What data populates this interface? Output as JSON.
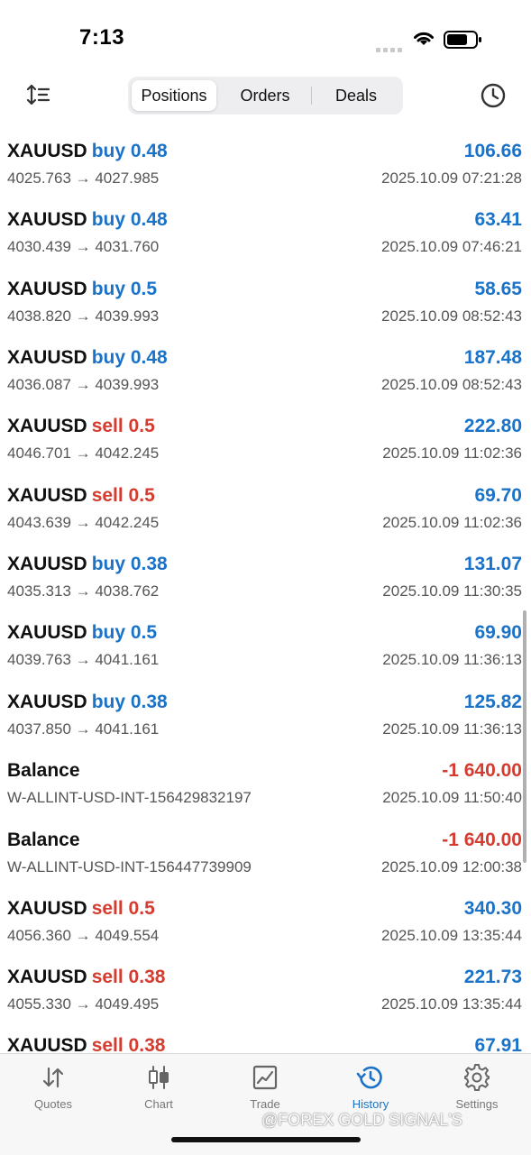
{
  "status_bar": {
    "time": "7:13"
  },
  "toolbar": {
    "segments": [
      {
        "label": "Positions",
        "active": true
      },
      {
        "label": "Orders",
        "active": false
      },
      {
        "label": "Deals",
        "active": false
      }
    ],
    "sort_icon": "sort-icon",
    "history_icon": "clock-icon"
  },
  "rows": [
    {
      "title": "XAUUSD",
      "direction": "buy 0.48",
      "dir_type": "buy",
      "profit": "106.66",
      "profit_sign": "pos",
      "detail": "4025.763 → 4027.985",
      "time": "2025.10.09 07:21:28"
    },
    {
      "title": "XAUUSD",
      "direction": "buy 0.48",
      "dir_type": "buy",
      "profit": "63.41",
      "profit_sign": "pos",
      "detail": "4030.439 → 4031.760",
      "time": "2025.10.09 07:46:21"
    },
    {
      "title": "XAUUSD",
      "direction": "buy 0.5",
      "dir_type": "buy",
      "profit": "58.65",
      "profit_sign": "pos",
      "detail": "4038.820 → 4039.993",
      "time": "2025.10.09 08:52:43"
    },
    {
      "title": "XAUUSD",
      "direction": "buy 0.48",
      "dir_type": "buy",
      "profit": "187.48",
      "profit_sign": "pos",
      "detail": "4036.087 → 4039.993",
      "time": "2025.10.09 08:52:43"
    },
    {
      "title": "XAUUSD",
      "direction": "sell 0.5",
      "dir_type": "sell",
      "profit": "222.80",
      "profit_sign": "pos",
      "detail": "4046.701 → 4042.245",
      "time": "2025.10.09 11:02:36"
    },
    {
      "title": "XAUUSD",
      "direction": "sell 0.5",
      "dir_type": "sell",
      "profit": "69.70",
      "profit_sign": "pos",
      "detail": "4043.639 → 4042.245",
      "time": "2025.10.09 11:02:36"
    },
    {
      "title": "XAUUSD",
      "direction": "buy 0.38",
      "dir_type": "buy",
      "profit": "131.07",
      "profit_sign": "pos",
      "detail": "4035.313 → 4038.762",
      "time": "2025.10.09 11:30:35"
    },
    {
      "title": "XAUUSD",
      "direction": "buy 0.5",
      "dir_type": "buy",
      "profit": "69.90",
      "profit_sign": "pos",
      "detail": "4039.763 → 4041.161",
      "time": "2025.10.09 11:36:13"
    },
    {
      "title": "XAUUSD",
      "direction": "buy 0.38",
      "dir_type": "buy",
      "profit": "125.82",
      "profit_sign": "pos",
      "detail": "4037.850 → 4041.161",
      "time": "2025.10.09 11:36:13"
    },
    {
      "title": "Balance",
      "direction": "",
      "dir_type": "",
      "profit": "-1 640.00",
      "profit_sign": "neg",
      "detail": "W-ALLINT-USD-INT-156429832197",
      "time": "2025.10.09 11:50:40"
    },
    {
      "title": "Balance",
      "direction": "",
      "dir_type": "",
      "profit": "-1 640.00",
      "profit_sign": "neg",
      "detail": "W-ALLINT-USD-INT-156447739909",
      "time": "2025.10.09 12:00:38"
    },
    {
      "title": "XAUUSD",
      "direction": "sell 0.5",
      "dir_type": "sell",
      "profit": "340.30",
      "profit_sign": "pos",
      "detail": "4056.360 → 4049.554",
      "time": "2025.10.09 13:35:44"
    },
    {
      "title": "XAUUSD",
      "direction": "sell 0.38",
      "dir_type": "sell",
      "profit": "221.73",
      "profit_sign": "pos",
      "detail": "4055.330 → 4049.495",
      "time": "2025.10.09 13:35:44"
    },
    {
      "title": "XAUUSD",
      "direction": "sell 0.38",
      "dir_type": "sell",
      "profit": "67.91",
      "profit_sign": "pos",
      "detail": "",
      "time": ""
    }
  ],
  "tabbar": {
    "tabs": [
      {
        "label": "Quotes",
        "icon": "quotes-arrows-icon",
        "active": false
      },
      {
        "label": "Chart",
        "icon": "candlestick-chart-icon",
        "active": false
      },
      {
        "label": "Trade",
        "icon": "trade-line-chart-icon",
        "active": false
      },
      {
        "label": "History",
        "icon": "history-clock-icon",
        "active": true
      },
      {
        "label": "Settings",
        "icon": "gear-icon",
        "active": false
      }
    ]
  },
  "watermark": "@FOREX GOLD SIGNAL'S",
  "colors": {
    "accent": "#1a73c8",
    "loss": "#d63b2f",
    "text": "#111111",
    "muted": "#555555"
  }
}
